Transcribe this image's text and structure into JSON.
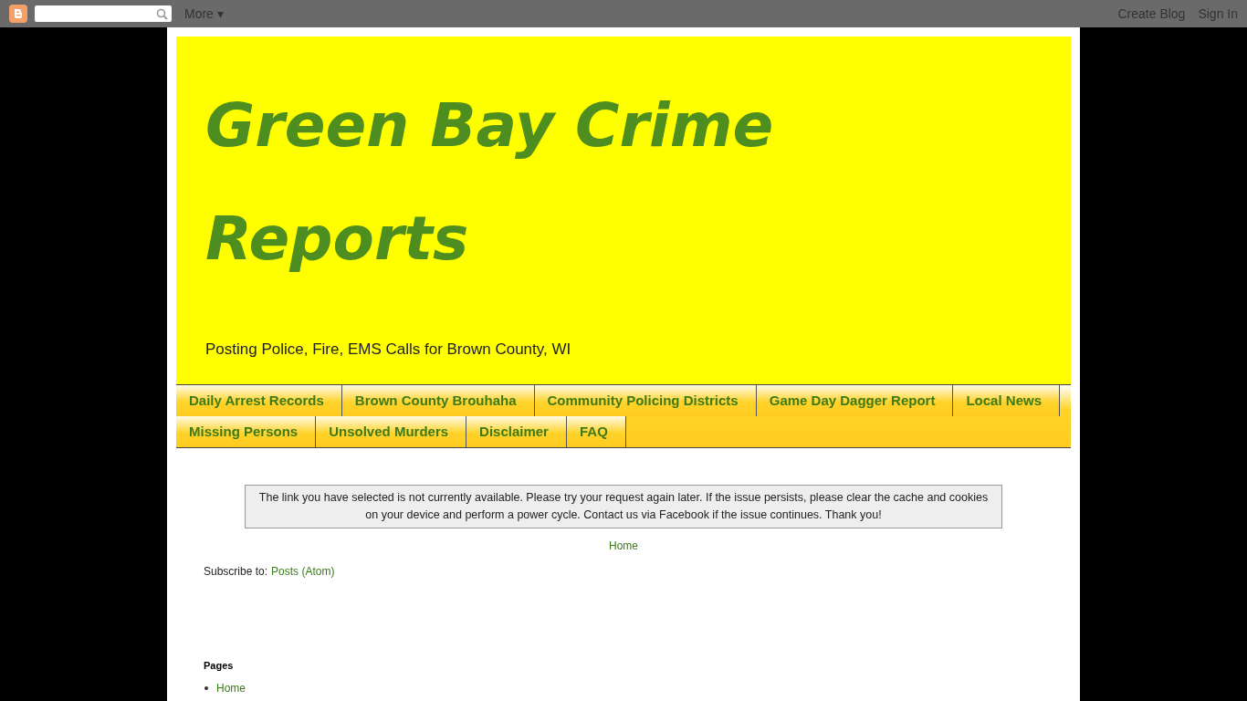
{
  "navbar": {
    "more": "More",
    "more_caret": "▾",
    "links": [
      "Create Blog",
      "Sign In"
    ]
  },
  "header": {
    "title": "Green Bay Crime Reports",
    "description": "Posting Police, Fire, EMS Calls for Brown County, WI"
  },
  "tabs": [
    {
      "label": "Daily Arrest Records"
    },
    {
      "label": "Brown County Brouhaha"
    },
    {
      "label": "Community Policing Districts"
    },
    {
      "label": "Game Day Dagger Report"
    },
    {
      "label": "Local News"
    },
    {
      "label": "Missing Persons"
    },
    {
      "label": "Unsolved Murders"
    },
    {
      "label": "Disclaimer"
    },
    {
      "label": "FAQ"
    }
  ],
  "notice": "The link you have selected is not currently available. Please try your request again later. If the issue persists, please clear the cache and cookies on your device and perform a power cycle. Contact us via Facebook if the issue continues. Thank you!",
  "home_link": "Home",
  "subscribe": {
    "label": "Subscribe to:",
    "link": "Posts (Atom)"
  },
  "pages": {
    "title": "Pages",
    "items": [
      "Home"
    ]
  }
}
